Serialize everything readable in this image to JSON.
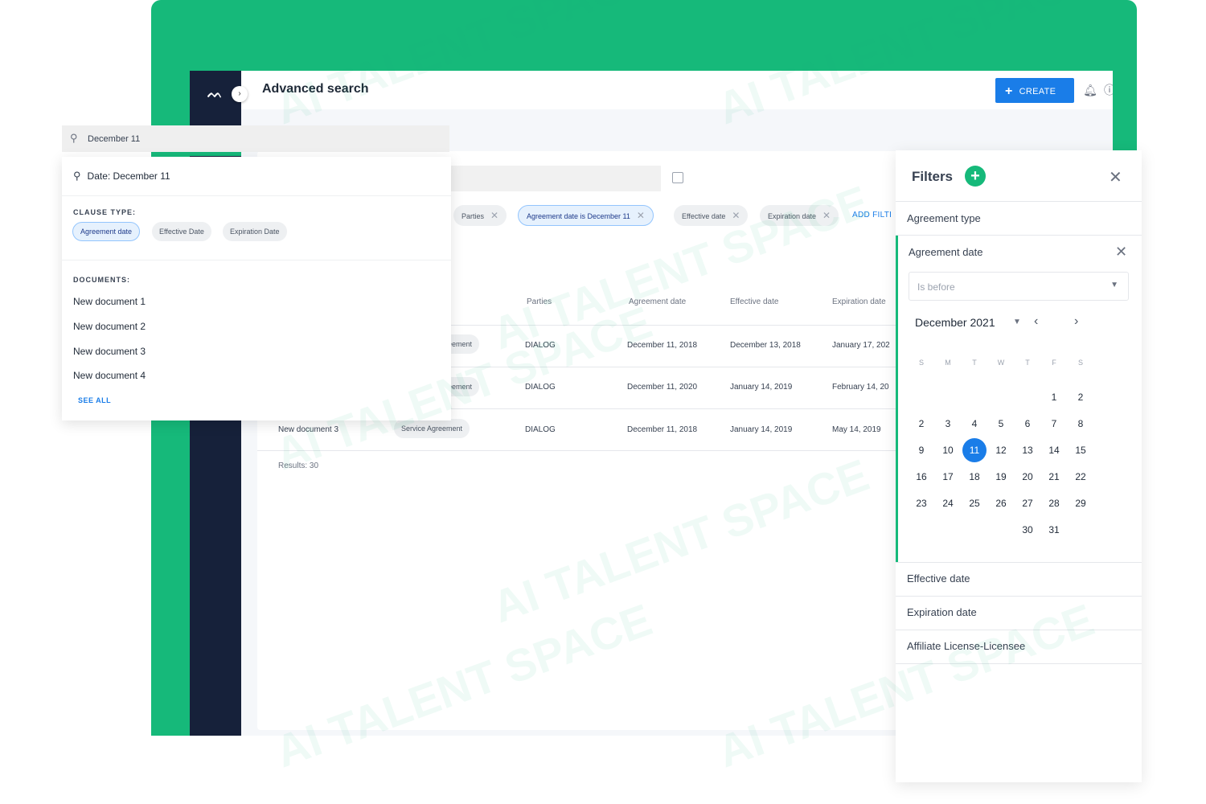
{
  "app": {
    "page_title": "Advanced search",
    "create_label": "CREATE",
    "toggle_glyph": "›",
    "icons": {
      "logo": "company-logo",
      "bell": "bell-icon",
      "help": "help-icon",
      "avatar": "user-avatar-icon"
    }
  },
  "search": {
    "query": "December 11",
    "calendar_icon": "calendar-icon"
  },
  "active_filters": {
    "chips": [
      "Parties",
      "Agreement date is December 11",
      "Effective date",
      "Expiration date"
    ],
    "add_filter_label": "ADD FILTI"
  },
  "table": {
    "headers": [
      "Parties",
      "Agreement date",
      "Effective date",
      "Expiration date"
    ],
    "rows": [
      {
        "type_partial": "eement",
        "parties": "DIALOG",
        "agreement_date": "December 11, 2018",
        "effective_date": "December 13, 2018",
        "expiration_date": "January 17, 202"
      },
      {
        "type_partial": "eement",
        "parties": "DIALOG",
        "agreement_date": "December 11, 2020",
        "effective_date": "January 14, 2019",
        "expiration_date": "February 14, 20"
      },
      {
        "name": "New document 3",
        "type": "Service Agreement",
        "parties": "DIALOG",
        "agreement_date": "December 11, 2018",
        "effective_date": "January 14, 2019",
        "expiration_date": "May 14, 2019"
      }
    ],
    "results_label": "Results: 30"
  },
  "dropdown": {
    "query_line": "Date: December 11",
    "clause_type_heading": "CLAUSE TYPE:",
    "clause_types": [
      "Agreement date",
      "Effective Date",
      "Expiration Date"
    ],
    "documents_heading": "DOCUMENTS:",
    "documents": [
      "New document 1",
      "New document 2",
      "New document 3",
      "New document 4"
    ],
    "see_all_label": "SEE ALL"
  },
  "filters_panel": {
    "title": "Filters",
    "add_glyph": "+",
    "close_glyph": "✕",
    "items_top": [
      "Agreement type"
    ],
    "active_item": "Agreement date",
    "condition_placeholder": "Is before",
    "calendar": {
      "month_label": "December 2021",
      "prev_glyph": "‹",
      "next_glyph": "›",
      "weekdays": [
        "S",
        "M",
        "T",
        "W",
        "T",
        "F",
        "S"
      ],
      "selected_day": 11,
      "weeks": [
        [
          "",
          "",
          "",
          "",
          "",
          "1",
          "2"
        ],
        [
          "2",
          "3",
          "4",
          "5",
          "6",
          "7",
          "8"
        ],
        [
          "9",
          "10",
          "11",
          "12",
          "13",
          "14",
          "15"
        ],
        [
          "16",
          "17",
          "18",
          "19",
          "20",
          "21",
          "22"
        ],
        [
          "23",
          "24",
          "25",
          "26",
          "27",
          "28",
          "29"
        ],
        [
          "",
          "",
          "",
          "",
          "30",
          "31",
          ""
        ]
      ]
    },
    "items_bottom": [
      "Effective date",
      "Expiration date",
      "Affiliate License-Licensee"
    ]
  },
  "colors": {
    "brand_green": "#16b97a",
    "sidebar_navy": "#16213a",
    "primary_blue": "#1a7de8"
  },
  "watermark_text": "AI TALENT SPACE"
}
